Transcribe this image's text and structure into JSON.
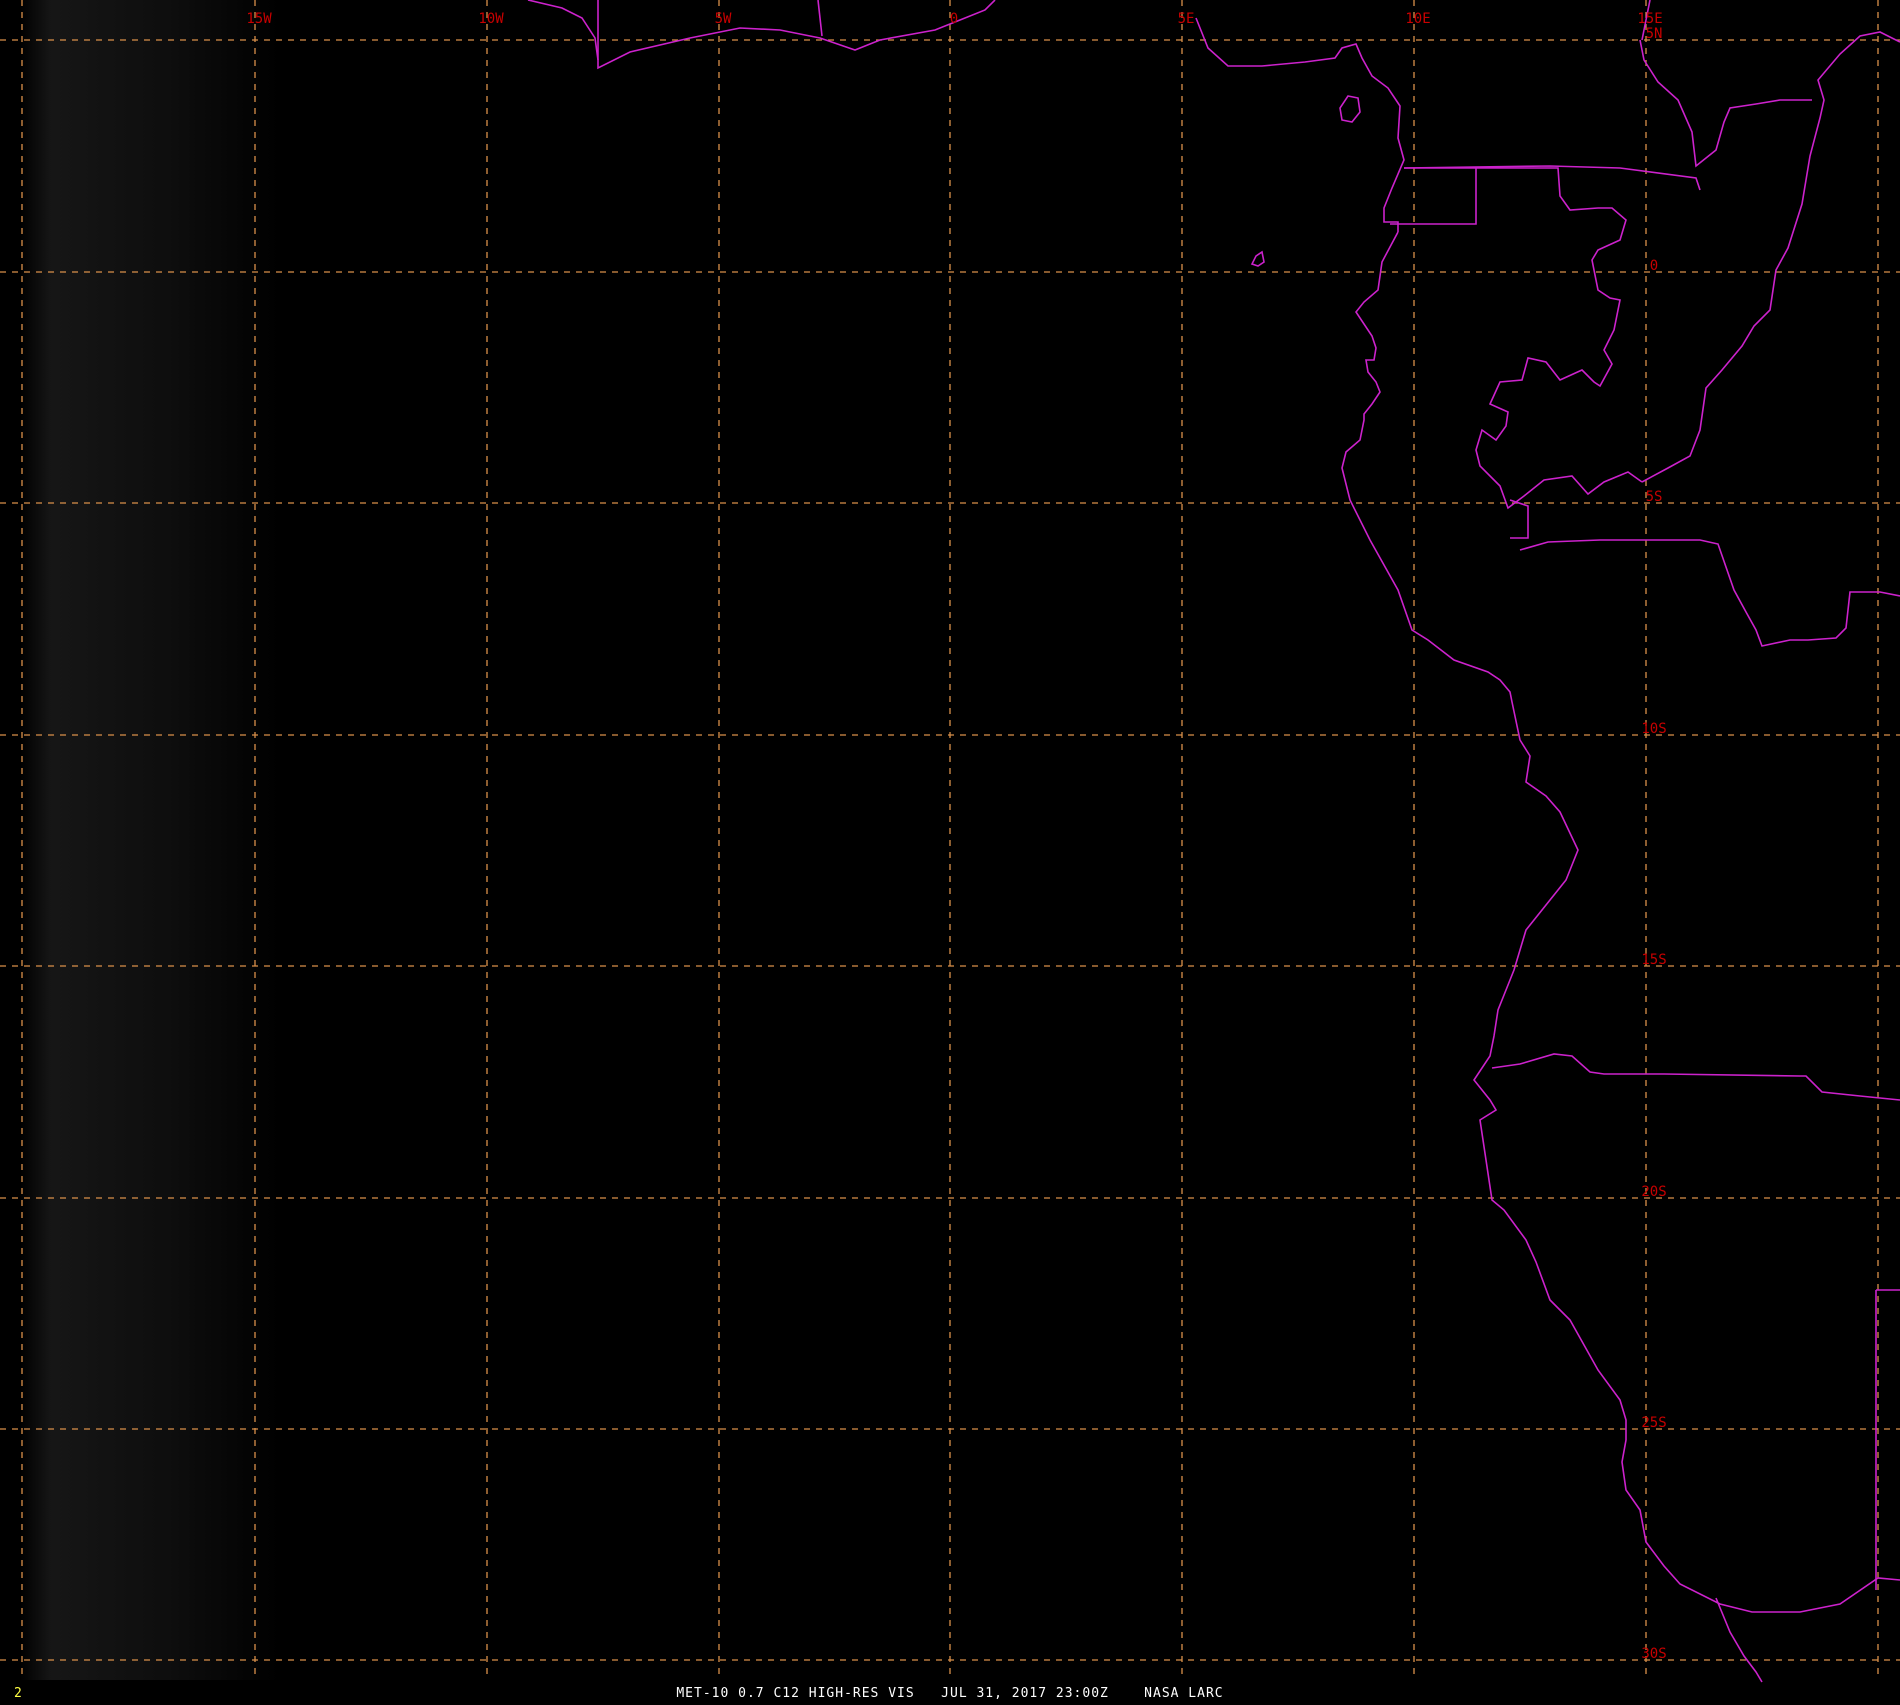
{
  "map": {
    "longitude_labels": [
      "15W",
      "10W",
      "5W",
      "0",
      "5E",
      "10E",
      "15E"
    ],
    "latitude_labels": [
      "5N",
      "0",
      "5S",
      "10S",
      "15S",
      "20S",
      "25S",
      "30S"
    ],
    "colors": {
      "background": "#000000",
      "grid": "#d9904a",
      "grid_labels": "#c80000",
      "borders": "#cc22cc",
      "caption": "#ffffff",
      "frame_number": "#ffff44"
    }
  },
  "footer": {
    "frame_number": "2",
    "caption": "MET-10 0.7 C12 HIGH-RES VIS   JUL 31, 2017 23:00Z    NASA LARC"
  }
}
